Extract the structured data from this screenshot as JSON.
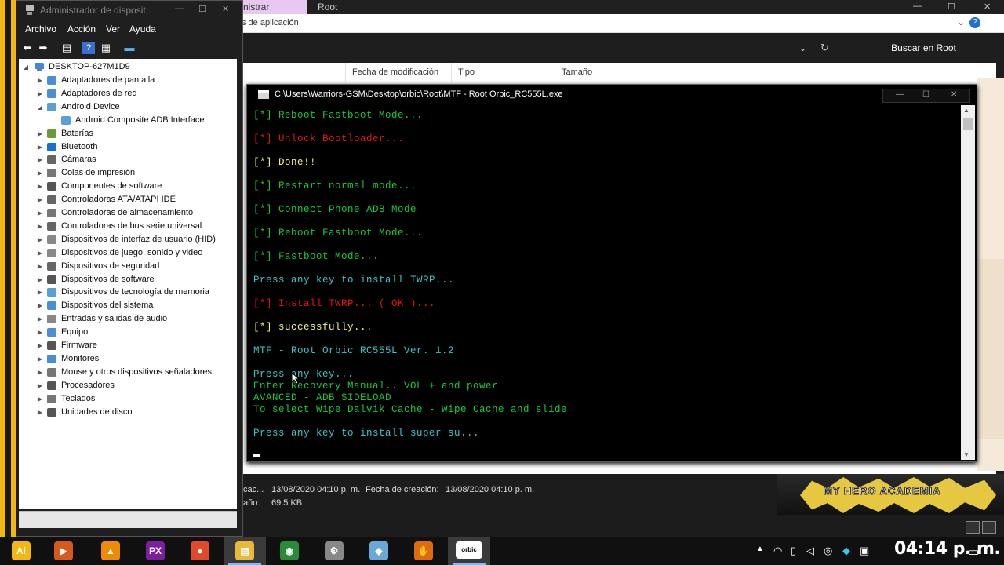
{
  "explorer": {
    "ribbon_tab_admin": "nistrar",
    "ribbon_tab_root": "Root",
    "ribbon2_text": "s de aplicación",
    "search_label": "Buscar en Root",
    "columns": [
      "Fecha de modificación",
      "Tipo",
      "Tamaño"
    ],
    "details": {
      "modified_prefix": "cac...",
      "modified_value": "13/08/2020 04:10 p. m.",
      "created_label": "Fecha de creación:",
      "created_value": "13/08/2020 04:10 p. m.",
      "size_prefix": "año:",
      "size_value": "69.5 KB"
    },
    "banner_text": "MY HERO ACADEMIA"
  },
  "device_manager": {
    "title": "Administrador de disposit...",
    "menu": [
      "Archivo",
      "Acción",
      "Ver",
      "Ayuda"
    ],
    "root": "DESKTOP-627M1D9",
    "items": [
      {
        "label": "Adaptadores de pantalla",
        "level": 1,
        "expander": "collapsed",
        "color": "#4a8fd6"
      },
      {
        "label": "Adaptadores de red",
        "level": 1,
        "expander": "collapsed",
        "color": "#4a8fd6"
      },
      {
        "label": "Android Device",
        "level": 1,
        "expander": "expanded",
        "color": "#5aa0d8"
      },
      {
        "label": "Android Composite ADB Interface",
        "level": 2,
        "expander": "none",
        "color": "#5aa0d8"
      },
      {
        "label": "Baterías",
        "level": 1,
        "expander": "collapsed",
        "color": "#6a9a3a"
      },
      {
        "label": "Bluetooth",
        "level": 1,
        "expander": "collapsed",
        "color": "#1a6fd6"
      },
      {
        "label": "Cámaras",
        "level": 1,
        "expander": "collapsed",
        "color": "#666666"
      },
      {
        "label": "Colas de impresión",
        "level": 1,
        "expander": "collapsed",
        "color": "#777777"
      },
      {
        "label": "Componentes de software",
        "level": 1,
        "expander": "collapsed",
        "color": "#555555"
      },
      {
        "label": "Controladoras ATA/ATAPI IDE",
        "level": 1,
        "expander": "collapsed",
        "color": "#666666"
      },
      {
        "label": "Controladoras de almacenamiento",
        "level": 1,
        "expander": "collapsed",
        "color": "#777777"
      },
      {
        "label": "Controladoras de bus serie universal",
        "level": 1,
        "expander": "collapsed",
        "color": "#666666"
      },
      {
        "label": "Dispositivos de interfaz de usuario (HID)",
        "level": 1,
        "expander": "collapsed",
        "color": "#888888"
      },
      {
        "label": "Dispositivos de juego, sonido y video",
        "level": 1,
        "expander": "collapsed",
        "color": "#888888"
      },
      {
        "label": "Dispositivos de seguridad",
        "level": 1,
        "expander": "collapsed",
        "color": "#666666"
      },
      {
        "label": "Dispositivos de software",
        "level": 1,
        "expander": "collapsed",
        "color": "#555555"
      },
      {
        "label": "Dispositivos de tecnología de memoria",
        "level": 1,
        "expander": "collapsed",
        "color": "#5aa0d8"
      },
      {
        "label": "Dispositivos del sistema",
        "level": 1,
        "expander": "collapsed",
        "color": "#4a8fd6"
      },
      {
        "label": "Entradas y salidas de audio",
        "level": 1,
        "expander": "collapsed",
        "color": "#888888"
      },
      {
        "label": "Equipo",
        "level": 1,
        "expander": "collapsed",
        "color": "#4a8fd6"
      },
      {
        "label": "Firmware",
        "level": 1,
        "expander": "collapsed",
        "color": "#555555"
      },
      {
        "label": "Monitores",
        "level": 1,
        "expander": "collapsed",
        "color": "#4a8fd6"
      },
      {
        "label": "Mouse y otros dispositivos señaladores",
        "level": 1,
        "expander": "collapsed",
        "color": "#777777"
      },
      {
        "label": "Procesadores",
        "level": 1,
        "expander": "collapsed",
        "color": "#555555"
      },
      {
        "label": "Teclados",
        "level": 1,
        "expander": "collapsed",
        "color": "#777777"
      },
      {
        "label": "Unidades de disco",
        "level": 1,
        "expander": "collapsed",
        "color": "#555555"
      }
    ]
  },
  "console": {
    "title": "C:\\Users\\Warriors-GSM\\Desktop\\orbic\\Root\\MTF - Root Orbic_RC555L.exe",
    "colors": {
      "green": "#13c93a",
      "red": "#e1141a",
      "yellow": "#f4f46e",
      "cyan": "#3ac6c6"
    },
    "lines": [
      {
        "text": "[*] Reboot Fastboot Mode...",
        "color": "green"
      },
      {
        "text": "[*] Unlock Bootloader...",
        "color": "red"
      },
      {
        "text": "[*] Done!!",
        "color": "yellow"
      },
      {
        "text": "[*] Restart normal mode...",
        "color": "green"
      },
      {
        "text": "[*] Connect Phone ADB Mode",
        "color": "green"
      },
      {
        "text": "[*] Reboot Fastboot Mode...",
        "color": "green"
      },
      {
        "text": "[*] Fastboot Mode...",
        "color": "green"
      },
      {
        "text": "Press any key to install TWRP...",
        "color": "cyan"
      },
      {
        "text": "[*] Install TWRP... ( OK )...",
        "color": "red"
      },
      {
        "text": "[*] successfully...",
        "color": "yellow"
      },
      {
        "text": "MTF - Root Orbic RC555L Ver. 1.2",
        "color": "cyan"
      },
      {
        "text": "Press any key...",
        "color": "cyan"
      },
      {
        "text": "Enter Recovery Manual.. VOL + and power",
        "color": "green"
      },
      {
        "text": "AVANCED - ADB SIDELOAD",
        "color": "green"
      },
      {
        "text": "To select Wipe Dalvik Cache - Wipe Cache and slide",
        "color": "green"
      },
      {
        "text": "Press any key to install super su...",
        "color": "cyan"
      }
    ]
  },
  "taskbar": {
    "apps": [
      {
        "name": "app-ai",
        "glyph": "Ai",
        "color": "#f2b711",
        "active": false
      },
      {
        "name": "app-media",
        "glyph": "▶",
        "color": "#d65a1e",
        "active": false
      },
      {
        "name": "app-vlc",
        "glyph": "▲",
        "color": "#f08a00",
        "active": false
      },
      {
        "name": "app-video-editor",
        "glyph": "PX",
        "color": "#7a1fa0",
        "active": false
      },
      {
        "name": "app-recorder",
        "glyph": "●",
        "color": "#e04a2a",
        "active": false
      },
      {
        "name": "app-file-explorer",
        "glyph": "▤",
        "color": "#e8b93a",
        "active": true
      },
      {
        "name": "app-chrome",
        "glyph": "◉",
        "color": "#2a8a3a",
        "active": false
      },
      {
        "name": "app-tool",
        "glyph": "⚙",
        "color": "#888888",
        "active": false
      },
      {
        "name": "app-notes",
        "glyph": "◆",
        "color": "#6aa8d8",
        "active": false
      },
      {
        "name": "app-orange",
        "glyph": "✋",
        "color": "#e06a10",
        "active": false
      },
      {
        "name": "app-orbic",
        "glyph": "orbic",
        "color": "#ffffff",
        "active": true
      }
    ],
    "clock": "04:14 p. m."
  }
}
